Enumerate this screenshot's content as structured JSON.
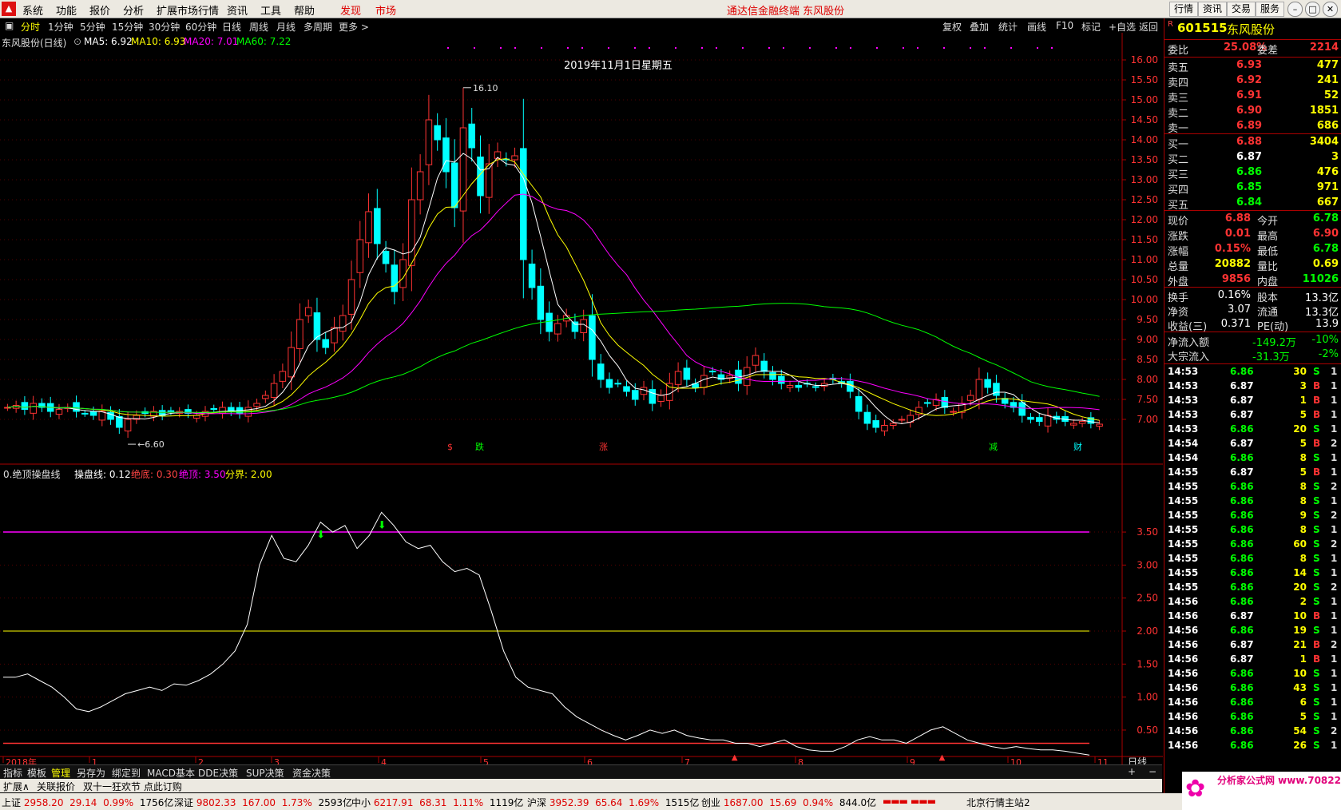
{
  "menu": {
    "items": [
      "系统",
      "功能",
      "报价",
      "分析",
      "扩展市场行情",
      "资讯",
      "工具",
      "帮助"
    ],
    "discover": "发现",
    "market": "市场",
    "title": "通达信金融终端  东风股份",
    "right_buttons": [
      "行情",
      "资讯",
      "交易",
      "服务"
    ]
  },
  "period": {
    "items": [
      "分时",
      "1分钟",
      "5分钟",
      "15分钟",
      "30分钟",
      "60分钟",
      "日线",
      "周线",
      "月线",
      "多周期",
      "更多 >"
    ],
    "right": [
      "复权",
      "叠加",
      "统计",
      "画线",
      "F10",
      "标记",
      "+自选",
      "返回"
    ]
  },
  "main_info": {
    "name": "东风股份(日线)",
    "ma5": "MA5: 6.92",
    "ma10": "MA10: 6.93",
    "ma20": "MA20: 7.01",
    "ma60": "MA60: 7.22",
    "date_label": "2019年11月1日星期五"
  },
  "indicator_info": {
    "name": "0.绝顶操盘线",
    "line": "操盘线: 0.12",
    "bottom": "绝底: 0.30",
    "top": "绝顶: 3.50",
    "boundary": "分界: 2.00"
  },
  "chart_data": {
    "type": "candlestick",
    "price_axis": {
      "ylim": [
        6.6,
        16.2
      ],
      "ticks": [
        7.0,
        7.5,
        8.0,
        8.5,
        9.0,
        9.5,
        10.0,
        10.5,
        11.0,
        11.5,
        12.0,
        12.5,
        13.0,
        13.5,
        14.0,
        14.5,
        15.0,
        15.5,
        16.0
      ]
    },
    "high_annotation": "16.10",
    "low_annotation": "6.60",
    "event_markers": [
      "$",
      "跌",
      "涨",
      "减",
      "财"
    ],
    "x_ticks": [
      "2018年",
      "1",
      "2",
      "3",
      "4",
      "5",
      "6",
      "7",
      "8",
      "9",
      "10",
      "11"
    ],
    "x_axis_unit": "日线",
    "closes": [
      7.3,
      7.35,
      7.25,
      7.4,
      7.3,
      7.2,
      7.25,
      7.3,
      7.2,
      7.15,
      7.1,
      7.2,
      7.0,
      6.8,
      7.0,
      7.1,
      7.15,
      7.2,
      7.1,
      7.2,
      7.2,
      7.15,
      7.1,
      7.2,
      7.25,
      7.3,
      7.2,
      7.15,
      7.3,
      7.4,
      7.6,
      7.9,
      8.2,
      8.8,
      9.5,
      9.8,
      9.0,
      8.8,
      9.3,
      9.6,
      10.5,
      11.5,
      12.2,
      11.4,
      10.9,
      10.2,
      11.0,
      12.5,
      13.2,
      14.5,
      14.0,
      13.2,
      12.3,
      14.3,
      13.8,
      12.6,
      13.4,
      13.7,
      13.5,
      13.6,
      11.0,
      10.3,
      9.5,
      9.2,
      9.4,
      9.6,
      9.2,
      9.5,
      8.5,
      8.0,
      7.8,
      7.9,
      7.7,
      7.5,
      7.8,
      7.4,
      7.6,
      7.9,
      8.2,
      8.0,
      7.8,
      8.1,
      8.2,
      8.0,
      8.1,
      7.9,
      8.3,
      8.6,
      8.2,
      8.0,
      7.9,
      7.85,
      7.8,
      7.9,
      7.8,
      7.9,
      8.0,
      7.9,
      7.7,
      7.2,
      6.9,
      6.8,
      6.85,
      6.9,
      7.0,
      7.1,
      7.3,
      7.4,
      7.5,
      7.3,
      7.2,
      7.4,
      7.6,
      8.0,
      7.8,
      7.6,
      7.4,
      7.3,
      7.1,
      7.0,
      6.95,
      7.1,
      7.0,
      6.95,
      6.9,
      6.95,
      6.9,
      6.88
    ],
    "ma5": 6.92,
    "ma10": 6.93,
    "ma20": 7.01,
    "ma60": 7.22,
    "indicator": {
      "name": "0.绝顶操盘线",
      "ylim": [
        0.1,
        3.9
      ],
      "ticks": [
        0.5,
        1.0,
        1.5,
        2.0,
        2.5,
        3.0,
        3.5
      ],
      "levels": {
        "bottom": 0.3,
        "top": 3.5,
        "boundary": 2.0
      },
      "values": [
        1.3,
        1.3,
        1.35,
        1.25,
        1.15,
        1.0,
        0.82,
        0.78,
        0.85,
        0.95,
        1.05,
        1.1,
        1.15,
        1.1,
        1.2,
        1.18,
        1.25,
        1.35,
        1.5,
        1.7,
        2.1,
        3.0,
        3.45,
        3.1,
        3.05,
        3.3,
        3.65,
        3.5,
        3.6,
        3.25,
        3.45,
        3.8,
        3.6,
        3.35,
        3.25,
        3.3,
        3.05,
        2.9,
        2.95,
        2.85,
        2.3,
        1.7,
        1.3,
        1.15,
        1.1,
        1.05,
        0.85,
        0.7,
        0.6,
        0.5,
        0.42,
        0.35,
        0.42,
        0.5,
        0.45,
        0.5,
        0.42,
        0.38,
        0.35,
        0.35,
        0.3,
        0.3,
        0.25,
        0.3,
        0.35,
        0.25,
        0.2,
        0.18,
        0.18,
        0.25,
        0.35,
        0.4,
        0.35,
        0.35,
        0.3,
        0.4,
        0.5,
        0.55,
        0.45,
        0.35,
        0.3,
        0.25,
        0.22,
        0.25,
        0.22,
        0.2,
        0.2,
        0.18,
        0.15,
        0.12
      ],
      "current": 0.12
    }
  },
  "quote": {
    "code": "601515",
    "name": "东风股份",
    "wei_bi_label": "委比",
    "wei_bi": "25.08%",
    "wei_cha_label": "委差",
    "wei_cha": "2214",
    "sells": [
      {
        "label": "卖五",
        "price": "6.93",
        "vol": "477"
      },
      {
        "label": "卖四",
        "price": "6.92",
        "vol": "241"
      },
      {
        "label": "卖三",
        "price": "6.91",
        "vol": "52"
      },
      {
        "label": "卖二",
        "price": "6.90",
        "vol": "1851"
      },
      {
        "label": "卖一",
        "price": "6.89",
        "vol": "686"
      }
    ],
    "buys": [
      {
        "label": "买一",
        "price": "6.88",
        "vol": "3404"
      },
      {
        "label": "买二",
        "price": "6.87",
        "vol": "3"
      },
      {
        "label": "买三",
        "price": "6.86",
        "vol": "476"
      },
      {
        "label": "买四",
        "price": "6.85",
        "vol": "971"
      },
      {
        "label": "买五",
        "price": "6.84",
        "vol": "667"
      }
    ],
    "stats": [
      {
        "l1": "现价",
        "v1": "6.88",
        "l2": "今开",
        "v2": "6.78"
      },
      {
        "l1": "涨跌",
        "v1": "0.01",
        "l2": "最高",
        "v2": "6.90"
      },
      {
        "l1": "涨幅",
        "v1": "0.15%",
        "l2": "最低",
        "v2": "6.78"
      },
      {
        "l1": "总量",
        "v1": "20882",
        "l2": "量比",
        "v2": "0.69"
      },
      {
        "l1": "外盘",
        "v1": "9856",
        "l2": "内盘",
        "v2": "11026"
      }
    ],
    "stats2": [
      {
        "l1": "换手",
        "v1": "0.16%",
        "l2": "股本",
        "v2": "13.3亿"
      },
      {
        "l1": "净资",
        "v1": "3.07",
        "l2": "流通",
        "v2": "13.3亿"
      },
      {
        "l1": "收益(三)",
        "v1": "0.371",
        "l2": "PE(动)",
        "v2": "13.9"
      }
    ],
    "flows": [
      {
        "label": "净流入额",
        "value": "-149.2万",
        "pct": "-10%"
      },
      {
        "label": "大宗流入",
        "value": "-31.3万",
        "pct": "-2%"
      }
    ]
  },
  "ticks": [
    {
      "t": "14:53",
      "p": "6.86",
      "v": "30",
      "d": "S",
      "n": "1"
    },
    {
      "t": "14:53",
      "p": "6.87",
      "v": "3",
      "d": "B",
      "n": "1"
    },
    {
      "t": "14:53",
      "p": "6.87",
      "v": "1",
      "d": "B",
      "n": "1"
    },
    {
      "t": "14:53",
      "p": "6.87",
      "v": "5",
      "d": "B",
      "n": "1"
    },
    {
      "t": "14:53",
      "p": "6.86",
      "v": "20",
      "d": "S",
      "n": "1"
    },
    {
      "t": "14:54",
      "p": "6.87",
      "v": "5",
      "d": "B",
      "n": "2"
    },
    {
      "t": "14:54",
      "p": "6.86",
      "v": "8",
      "d": "S",
      "n": "1"
    },
    {
      "t": "14:55",
      "p": "6.87",
      "v": "5",
      "d": "B",
      "n": "1"
    },
    {
      "t": "14:55",
      "p": "6.86",
      "v": "8",
      "d": "S",
      "n": "2"
    },
    {
      "t": "14:55",
      "p": "6.86",
      "v": "8",
      "d": "S",
      "n": "1"
    },
    {
      "t": "14:55",
      "p": "6.86",
      "v": "9",
      "d": "S",
      "n": "2"
    },
    {
      "t": "14:55",
      "p": "6.86",
      "v": "8",
      "d": "S",
      "n": "1"
    },
    {
      "t": "14:55",
      "p": "6.86",
      "v": "60",
      "d": "S",
      "n": "2"
    },
    {
      "t": "14:55",
      "p": "6.86",
      "v": "8",
      "d": "S",
      "n": "1"
    },
    {
      "t": "14:55",
      "p": "6.86",
      "v": "14",
      "d": "S",
      "n": "1"
    },
    {
      "t": "14:55",
      "p": "6.86",
      "v": "20",
      "d": "S",
      "n": "2"
    },
    {
      "t": "14:56",
      "p": "6.86",
      "v": "2",
      "d": "S",
      "n": "1"
    },
    {
      "t": "14:56",
      "p": "6.87",
      "v": "10",
      "d": "B",
      "n": "1"
    },
    {
      "t": "14:56",
      "p": "6.86",
      "v": "19",
      "d": "S",
      "n": "1"
    },
    {
      "t": "14:56",
      "p": "6.87",
      "v": "21",
      "d": "B",
      "n": "2"
    },
    {
      "t": "14:56",
      "p": "6.87",
      "v": "1",
      "d": "B",
      "n": "1"
    },
    {
      "t": "14:56",
      "p": "6.86",
      "v": "10",
      "d": "S",
      "n": "1"
    },
    {
      "t": "14:56",
      "p": "6.86",
      "v": "43",
      "d": "S",
      "n": "1"
    },
    {
      "t": "14:56",
      "p": "6.86",
      "v": "6",
      "d": "S",
      "n": "1"
    },
    {
      "t": "14:56",
      "p": "6.86",
      "v": "5",
      "d": "S",
      "n": "1"
    },
    {
      "t": "14:56",
      "p": "6.86",
      "v": "54",
      "d": "S",
      "n": "2"
    },
    {
      "t": "14:56",
      "p": "6.86",
      "v": "26",
      "d": "S",
      "n": "1"
    }
  ],
  "tabs": [
    "指标",
    "模板",
    "管理",
    "另存为",
    "绑定到",
    "MACD基本",
    "DDE决策",
    "SUP决策",
    "资金决策"
  ],
  "ext": [
    "扩展∧",
    "关联报价",
    "双十一狂欢节 点此订购"
  ],
  "status": [
    {
      "name": "上证",
      "price": "2958.20",
      "chg": "29.14",
      "pct": "0.99%",
      "amt": "1756亿"
    },
    {
      "name": "深证",
      "price": "9802.33",
      "chg": "167.00",
      "pct": "1.73%",
      "amt": "2593亿"
    },
    {
      "name": "中小",
      "price": "6217.91",
      "chg": "68.31",
      "pct": "1.11%",
      "amt": "1119亿"
    },
    {
      "name": "沪深",
      "price": "3952.39",
      "chg": "65.64",
      "pct": "1.69%",
      "amt": "1515亿"
    },
    {
      "name": "创业",
      "price": "1687.00",
      "chg": "15.69",
      "pct": "0.94%",
      "amt": "844.0亿"
    }
  ],
  "status_server": "北京行情主站2",
  "watermark": "分析家公式网 www.70822.com",
  "colors": {
    "up": "#ff3333",
    "down": "#00ffff",
    "ma5": "#ffffff",
    "ma10": "#ffff00",
    "ma20": "#ff00ff",
    "ma60": "#00ff00"
  }
}
